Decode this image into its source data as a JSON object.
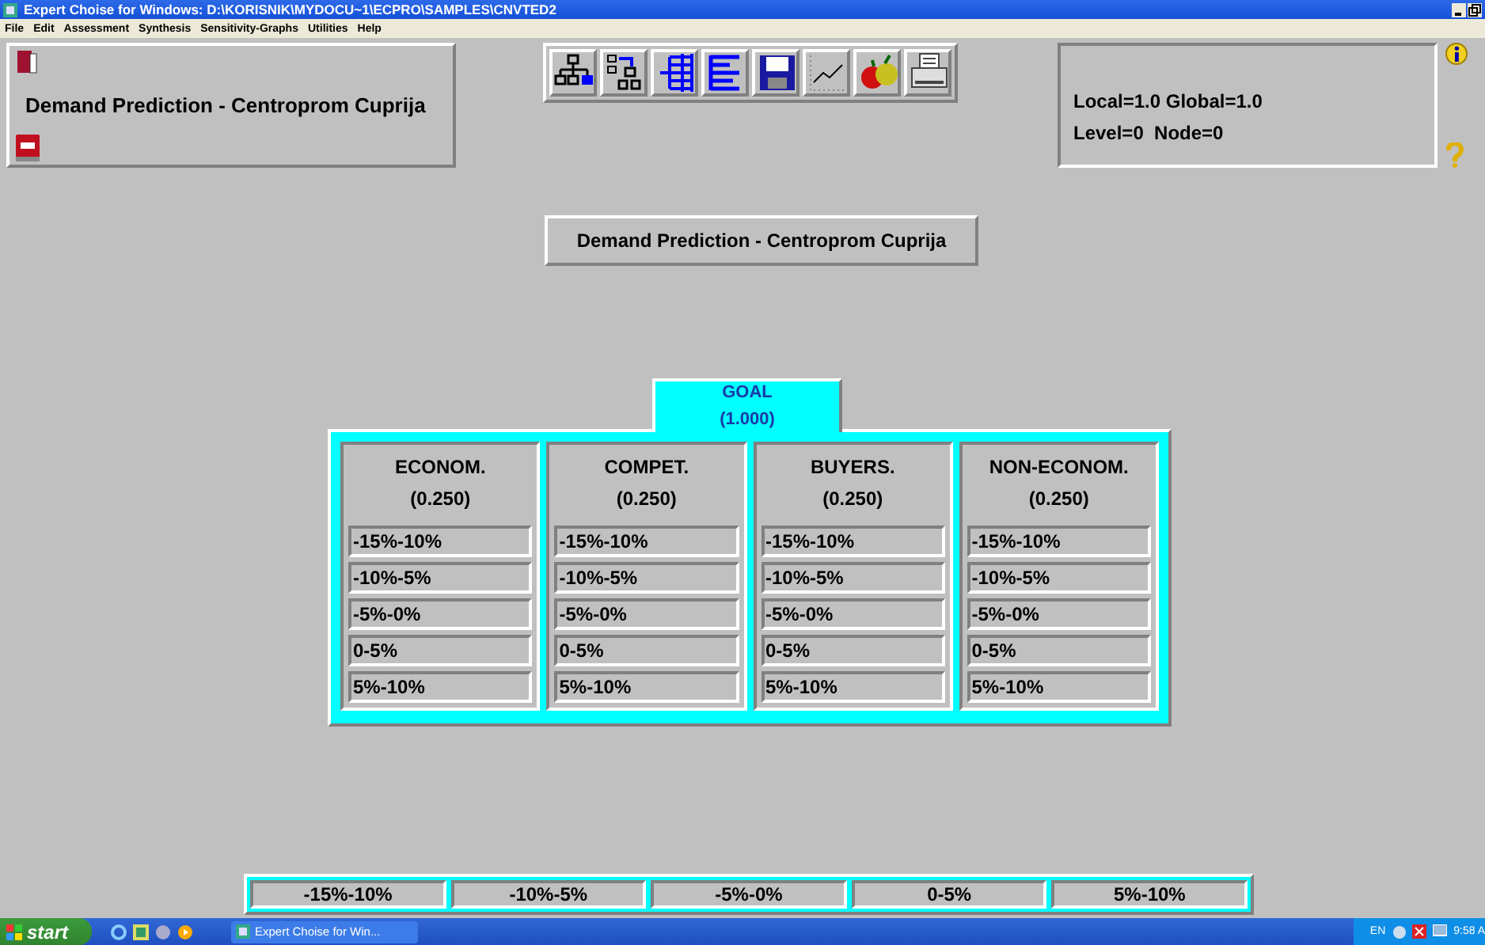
{
  "window": {
    "title": "Expert Choise for Windows: D:\\KORISNIK\\MYDOCU~1\\ECPRO\\SAMPLES\\CNVTED2"
  },
  "menu": [
    "File",
    "Edit",
    "Assessment",
    "Synthesis",
    "Sensitivity-Graphs",
    "Utilities",
    "Help"
  ],
  "model_panel": {
    "title": "Demand Prediction - Centroprom Cuprija"
  },
  "info_panel": {
    "lines": [
      "Local=1.0 Global=1.0",
      "Level=0  Node=0"
    ]
  },
  "document_title": "Demand Prediction - Centroprom Cuprija",
  "goal": {
    "name": "GOAL",
    "priority": "(1.000)"
  },
  "criteria": [
    {
      "name": "ECONOM.",
      "priority": "(0.250)",
      "items": [
        "-15%-10%",
        "-10%-5%",
        "-5%-0%",
        "0-5%",
        "5%-10%"
      ]
    },
    {
      "name": "COMPET.",
      "priority": "(0.250)",
      "items": [
        "-15%-10%",
        "-10%-5%",
        "-5%-0%",
        "0-5%",
        "5%-10%"
      ]
    },
    {
      "name": "BUYERS.",
      "priority": "(0.250)",
      "items": [
        "-15%-10%",
        "-10%-5%",
        "-5%-0%",
        "0-5%",
        "5%-10%"
      ]
    },
    {
      "name": "NON-ECONOM.",
      "priority": "(0.250)",
      "items": [
        "-15%-10%",
        "-10%-5%",
        "-5%-0%",
        "0-5%",
        "5%-10%"
      ]
    }
  ],
  "alternatives": [
    "-15%-10%",
    "-10%-5%",
    "-5%-0%",
    "0-5%",
    "5%-10%"
  ],
  "taskbar": {
    "start": "start",
    "task": "Expert Choise for Win...",
    "language": "EN",
    "clock": "9:58 A"
  }
}
